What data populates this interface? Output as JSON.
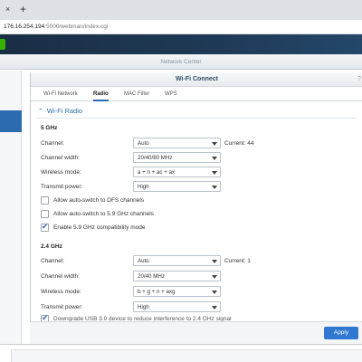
{
  "browser": {
    "close_glyph": "×",
    "newtab_glyph": "+",
    "url_host": "176.16.254.194",
    "url_path": ":5000/webman/index.cgi"
  },
  "dsm": {
    "window_title": "Network Center"
  },
  "wifi": {
    "title": "Wi-Fi Connect",
    "title_right": "?",
    "tabs": [
      "Wi-Fi Network",
      "Radio",
      "MAC Filter",
      "WPS"
    ],
    "active_tab": "Radio",
    "section_title": "Wi-Fi Radio",
    "band5": {
      "heading": "5 GHz",
      "fields": [
        {
          "label": "Channel:",
          "value": "Auto",
          "current": "Current: 44"
        },
        {
          "label": "Channel width:",
          "value": "20/40/80 MHz"
        },
        {
          "label": "Wireless mode:",
          "value": "a + n + ac + ax"
        },
        {
          "label": "Transmit power:",
          "value": "High"
        }
      ],
      "checkboxes": [
        {
          "label": "Allow auto-switch to DFS channels",
          "checked": false
        },
        {
          "label": "Allow auto-switch to 5.9 GHz channels",
          "checked": false
        },
        {
          "label": "Enable 5.9 GHz compatibility mode",
          "checked": true
        }
      ]
    },
    "band24": {
      "heading": "2.4 GHz",
      "fields": [
        {
          "label": "Channel:",
          "value": "Auto",
          "current": "Current: 1"
        },
        {
          "label": "Channel width:",
          "value": "20/40 MHz"
        },
        {
          "label": "Wireless mode:",
          "value": "b + g + n + axg"
        },
        {
          "label": "Transmit power:",
          "value": "High"
        }
      ],
      "checkboxes": [
        {
          "label": "Downgrade USB 3.0 device to reduce interference to 2.4 GHz signal",
          "checked": true
        }
      ]
    },
    "apply_label": "Apply"
  }
}
